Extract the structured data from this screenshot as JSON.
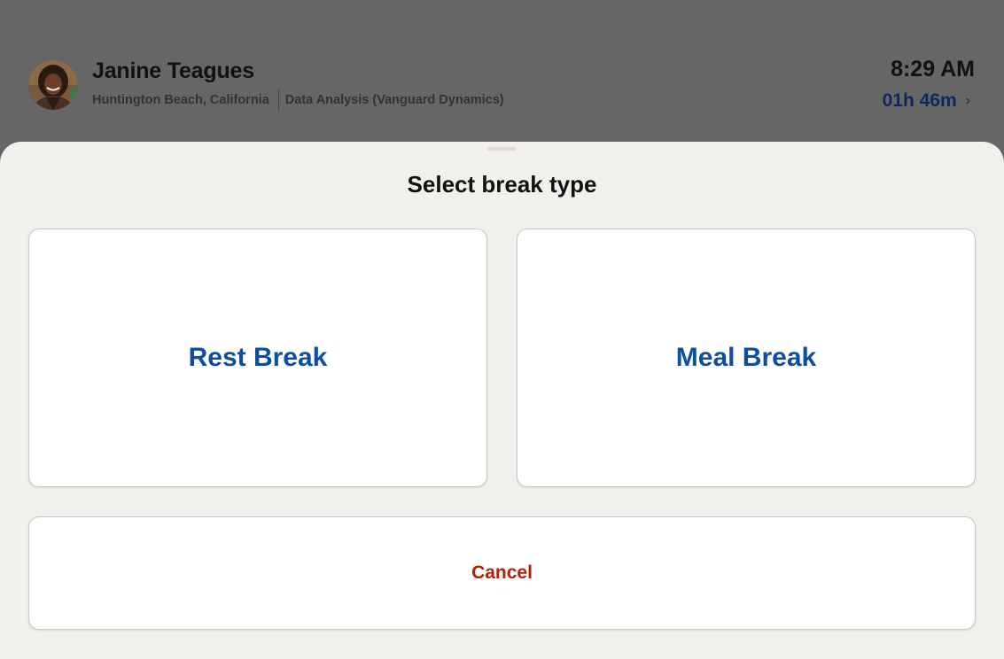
{
  "colors": {
    "overlay_background": "#666666",
    "sheet_background": "#f1f0ed",
    "card_background": "#ffffff",
    "primary_text": "#111111",
    "option_text": "#0d4f9e",
    "duration_link": "#0a2a5c",
    "cancel_text": "#b51f0a"
  },
  "header": {
    "employee_name": "Janine Teagues",
    "location": "Huntington Beach, California",
    "department": "Data Analysis (Vanguard Dynamics)",
    "clock_time": "8:29 AM",
    "elapsed_duration": "01h 46m",
    "avatar_icon": "person-avatar-photo",
    "chevron_icon": "chevron-right-icon"
  },
  "sheet": {
    "title": "Select break type",
    "options": [
      {
        "label": "Rest Break"
      },
      {
        "label": "Meal Break"
      }
    ],
    "cancel_label": "Cancel"
  }
}
